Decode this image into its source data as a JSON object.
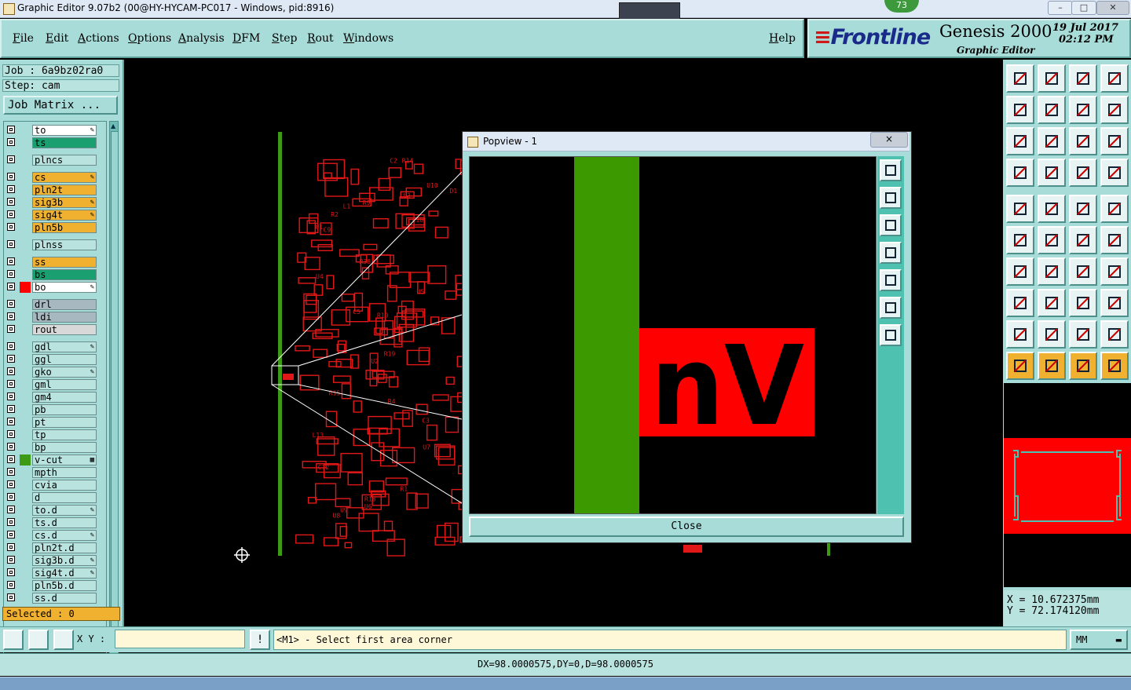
{
  "window": {
    "title": "Graphic Editor 9.07b2 (00@HY-HYCAM-PC017 - Windows, pid:8916)",
    "badge": "73"
  },
  "menu": [
    "File",
    "Edit",
    "Actions",
    "Options",
    "Analysis",
    "DFM",
    "Step",
    "Rout",
    "Windows"
  ],
  "help_label": "Help",
  "brand": {
    "logo": "Frontline",
    "product": "Genesis 2000",
    "subtitle": "Graphic Editor",
    "date": "19 Jul 2017",
    "time": "02:12 PM"
  },
  "job": {
    "job_label": "Job : 6a9bz02ra0",
    "step_label": "Step: cam",
    "matrix_button": "Job Matrix ..."
  },
  "layers": [
    {
      "name": "to",
      "color": "#ffffff",
      "mark": "✎"
    },
    {
      "name": "ts",
      "color": "#1aa070",
      "mark": ""
    },
    {
      "name": "plncs",
      "color": "#b8e3df",
      "mark": ""
    },
    {
      "name": "cs",
      "color": "#f0b030",
      "mark": "✎"
    },
    {
      "name": "pln2t",
      "color": "#f0b030",
      "mark": ""
    },
    {
      "name": "sig3b",
      "color": "#f0b030",
      "mark": "✎"
    },
    {
      "name": "sig4t",
      "color": "#f0b030",
      "mark": "✎"
    },
    {
      "name": "pln5b",
      "color": "#f0b030",
      "mark": ""
    },
    {
      "name": "plnss",
      "color": "#b8e3df",
      "mark": ""
    },
    {
      "name": "ss",
      "color": "#f0b030",
      "mark": ""
    },
    {
      "name": "bs",
      "color": "#1aa070",
      "mark": ""
    },
    {
      "name": "bo",
      "color": "#ffffff",
      "mark": "✎"
    },
    {
      "name": "drl",
      "color": "#a8b8c0",
      "mark": ""
    },
    {
      "name": "ldi",
      "color": "#a8b8c0",
      "mark": ""
    },
    {
      "name": "rout",
      "color": "#d8d8d8",
      "mark": ""
    },
    {
      "name": "gdl",
      "color": "#b8e3df",
      "mark": "✎"
    },
    {
      "name": "ggl",
      "color": "#b8e3df",
      "mark": ""
    },
    {
      "name": "gko",
      "color": "#b8e3df",
      "mark": "✎"
    },
    {
      "name": "gml",
      "color": "#b8e3df",
      "mark": ""
    },
    {
      "name": "gm4",
      "color": "#b8e3df",
      "mark": ""
    },
    {
      "name": "pb",
      "color": "#b8e3df",
      "mark": ""
    },
    {
      "name": "pt",
      "color": "#b8e3df",
      "mark": ""
    },
    {
      "name": "tp",
      "color": "#b8e3df",
      "mark": ""
    },
    {
      "name": "bp",
      "color": "#b8e3df",
      "mark": ""
    },
    {
      "name": "v-cut",
      "color": "#b8e3df",
      "mark": "▦"
    },
    {
      "name": "mpth",
      "color": "#b8e3df",
      "mark": ""
    },
    {
      "name": "cvia",
      "color": "#b8e3df",
      "mark": ""
    },
    {
      "name": "d",
      "color": "#b8e3df",
      "mark": ""
    },
    {
      "name": "to.d",
      "color": "#b8e3df",
      "mark": "✎"
    },
    {
      "name": "ts.d",
      "color": "#b8e3df",
      "mark": ""
    },
    {
      "name": "cs.d",
      "color": "#b8e3df",
      "mark": "✎"
    },
    {
      "name": "pln2t.d",
      "color": "#b8e3df",
      "mark": ""
    },
    {
      "name": "sig3b.d",
      "color": "#b8e3df",
      "mark": "✎"
    },
    {
      "name": "sig4t.d",
      "color": "#b8e3df",
      "mark": "✎"
    },
    {
      "name": "pln5b.d",
      "color": "#b8e3df",
      "mark": ""
    },
    {
      "name": "ss.d",
      "color": "#b8e3df",
      "mark": ""
    }
  ],
  "layer_swatches": {
    "bo": "#ff0000",
    "v-cut": "#3c9a14"
  },
  "selected_label": "Selected : 0",
  "coords": {
    "x": "X = 10.672375mm",
    "y": "Y = 72.174120mm"
  },
  "bottom": {
    "xy_label": "X Y :",
    "xy_value": "",
    "prompt": "<M1> - Select first area corner",
    "units": "MM"
  },
  "status": "DX=98.0000575,DY=0,D=98.0000575",
  "popview": {
    "title": "Popview - 1",
    "close_button": "Close",
    "close_x": "×",
    "silkscreen_text": "nV"
  },
  "pcb_labels": [
    "U2",
    "U3",
    "C10",
    "C12",
    "R14",
    "R15",
    "U4",
    "R18",
    "R19",
    "U5",
    "L1",
    "U1",
    "R38",
    "C2",
    "U8",
    "C5",
    "R1",
    "R2",
    "D1",
    "U10",
    "R9",
    "R4",
    "U6",
    "C9",
    "R10",
    "U7",
    "C3",
    "L13",
    "U9"
  ],
  "colors": {
    "accent": "#a8dcd8",
    "pcb_red": "#e01818",
    "board_edge_green": "#3c9a14",
    "active_orange": "#f0b030"
  }
}
